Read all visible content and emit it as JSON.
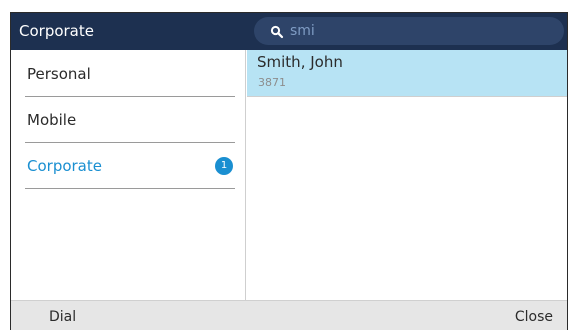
{
  "header": {
    "title": "Corporate",
    "search": {
      "query": "smi",
      "icon": "search-icon"
    }
  },
  "sidebar": {
    "items": [
      {
        "label": "Personal",
        "active": false
      },
      {
        "label": "Mobile",
        "active": false
      },
      {
        "label": "Corporate",
        "active": true,
        "badge": "1"
      }
    ]
  },
  "results": [
    {
      "name": "Smith, John",
      "number": "3871",
      "selected": true
    }
  ],
  "softkeys": {
    "left_label": "Dial",
    "right_label": "Close"
  },
  "colors": {
    "header_bg": "#1d3050",
    "search_bg": "#2e4469",
    "accent": "#1a8fd1",
    "selected_row": "#b7e3f4",
    "softkey_bar": "#e6e6e6"
  }
}
